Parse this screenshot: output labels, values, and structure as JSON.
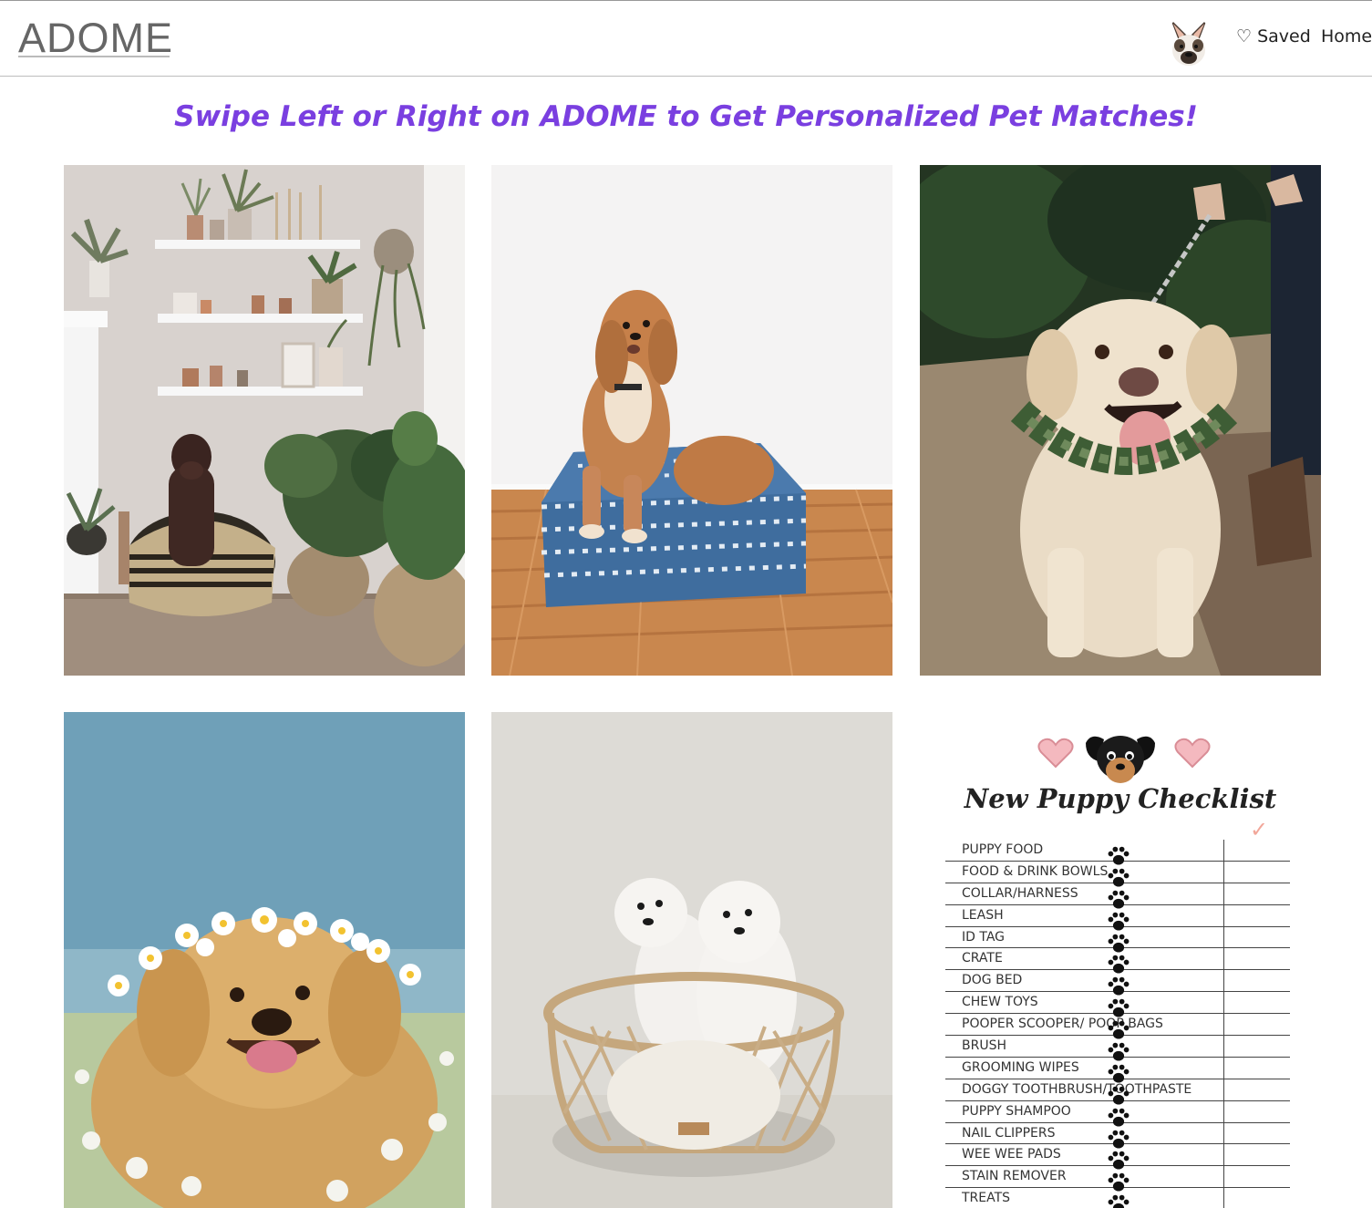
{
  "header": {
    "logo_text": "ADOME",
    "nav": {
      "saved_label": "♡ Saved",
      "home_label": "Home"
    }
  },
  "main": {
    "heading": "Swipe Left or Right on ADOME to Get Personalized Pet Matches!"
  },
  "checklist": {
    "title": "New Puppy Checklist",
    "check_mark": "✓",
    "items": [
      "PUPPY FOOD",
      "FOOD & DRINK BOWLS",
      "COLLAR/HARNESS",
      "LEASH",
      "ID TAG",
      "CRATE",
      "DOG BED",
      "CHEW TOYS",
      "POOPER SCOOPER/ POOP BAGS",
      "BRUSH",
      "GROOMING WIPES",
      "DOGGY TOOTHBRUSH/TOOTHPASTE",
      "PUPPY SHAMPOO",
      "NAIL CLIPPERS",
      "WEE WEE PADS",
      "STAIN REMOVER",
      "TREATS"
    ]
  }
}
